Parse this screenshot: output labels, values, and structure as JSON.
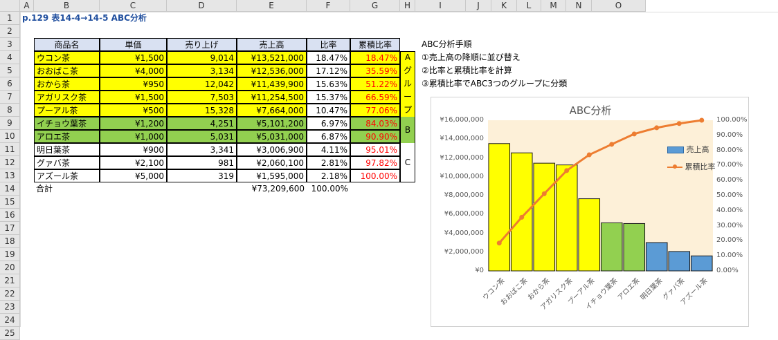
{
  "sheet": {
    "columns": [
      "A",
      "B",
      "C",
      "D",
      "E",
      "F",
      "G",
      "H",
      "I",
      "J",
      "K",
      "L",
      "M",
      "N",
      "O"
    ],
    "rows": [
      "1",
      "2",
      "3",
      "4",
      "5",
      "6",
      "7",
      "8",
      "9",
      "10",
      "11",
      "12",
      "13",
      "14",
      "15",
      "16",
      "17",
      "18",
      "19",
      "20",
      "21",
      "22",
      "23",
      "24",
      "25"
    ],
    "title": "p.129  表14-4→14-5  ABC分析",
    "headers": [
      "商品名",
      "単価",
      "売り上げ",
      "売上高",
      "比率",
      "累積比率"
    ],
    "table": [
      {
        "name": "ウコン茶",
        "price": "¥1,500",
        "qty": "9,014",
        "sales": "¥13,521,000",
        "ratio": "18.47%",
        "cum": "18.47%",
        "group": "A"
      },
      {
        "name": "おおばこ茶",
        "price": "¥4,000",
        "qty": "3,134",
        "sales": "¥12,536,000",
        "ratio": "17.12%",
        "cum": "35.59%",
        "group": "A"
      },
      {
        "name": "おから茶",
        "price": "¥950",
        "qty": "12,042",
        "sales": "¥11,439,900",
        "ratio": "15.63%",
        "cum": "51.22%",
        "group": "A"
      },
      {
        "name": "アガリスク茶",
        "price": "¥1,500",
        "qty": "7,503",
        "sales": "¥11,254,500",
        "ratio": "15.37%",
        "cum": "66.59%",
        "group": "A"
      },
      {
        "name": "プーアル茶",
        "price": "¥500",
        "qty": "15,328",
        "sales": "¥7,664,000",
        "ratio": "10.47%",
        "cum": "77.06%",
        "group": "A"
      },
      {
        "name": "イチョウ葉茶",
        "price": "¥1,200",
        "qty": "4,251",
        "sales": "¥5,101,200",
        "ratio": "6.97%",
        "cum": "84.03%",
        "group": "B"
      },
      {
        "name": "アロエ茶",
        "price": "¥1,000",
        "qty": "5,031",
        "sales": "¥5,031,000",
        "ratio": "6.87%",
        "cum": "90.90%",
        "group": "B"
      },
      {
        "name": "明日葉茶",
        "price": "¥900",
        "qty": "3,341",
        "sales": "¥3,006,900",
        "ratio": "4.11%",
        "cum": "95.01%",
        "group": "C"
      },
      {
        "name": "グァバ茶",
        "price": "¥2,100",
        "qty": "981",
        "sales": "¥2,060,100",
        "ratio": "2.81%",
        "cum": "97.82%",
        "group": "C"
      },
      {
        "name": "アズール茶",
        "price": "¥5,000",
        "qty": "319",
        "sales": "¥1,595,000",
        "ratio": "2.18%",
        "cum": "100.00%",
        "group": "C"
      }
    ],
    "total_label": "合計",
    "total_sales": "¥73,209,600",
    "total_ratio": "100.00%",
    "group_a_label": [
      "A",
      "グ",
      "ル",
      "ー",
      "プ"
    ],
    "group_b_label": "B",
    "group_c_label": "C",
    "procedure": {
      "title": "ABC分析手順",
      "steps": [
        "①売上高の降順に並び替え",
        "②比率と累積比率を計算",
        "③累積比率でABC3つのグループに分類"
      ]
    },
    "colors": {
      "group_a": "#ffff00",
      "group_b": "#92d050",
      "group_c": "#5b9bd5",
      "line": "#ed7d31",
      "header": "#d9e1f2"
    }
  },
  "chart_data": {
    "type": "bar",
    "title": "ABC分析",
    "categories": [
      "ウコン茶",
      "おおばこ茶",
      "おから茶",
      "アガリスク茶",
      "プーアル茶",
      "イチョウ葉茶",
      "アロエ茶",
      "明日葉茶",
      "グァバ茶",
      "アズール茶"
    ],
    "series": [
      {
        "name": "売上高",
        "type": "bar",
        "axis": "left",
        "values": [
          13521000,
          12536000,
          11439900,
          11254500,
          7664000,
          5101200,
          5031000,
          3006900,
          2060100,
          1595000
        ]
      },
      {
        "name": "累積比率",
        "type": "line",
        "axis": "right",
        "values": [
          18.47,
          35.59,
          51.22,
          66.59,
          77.06,
          84.03,
          90.9,
          95.01,
          97.82,
          100.0
        ]
      }
    ],
    "bar_colors": [
      "#ffff00",
      "#ffff00",
      "#ffff00",
      "#ffff00",
      "#ffff00",
      "#92d050",
      "#92d050",
      "#5b9bd5",
      "#5b9bd5",
      "#5b9bd5"
    ],
    "ylim": [
      0,
      16000000
    ],
    "y_ticks": [
      "¥16,000,000",
      "¥14,000,000",
      "¥12,000,000",
      "¥10,000,000",
      "¥8,000,000",
      "¥6,000,000",
      "¥4,000,000",
      "¥2,000,000",
      "¥0"
    ],
    "y2lim": [
      0,
      100
    ],
    "y2_ticks": [
      "100.00%",
      "90.00%",
      "80.00%",
      "70.00%",
      "60.00%",
      "50.00%",
      "40.00%",
      "30.00%",
      "20.00%",
      "10.00%",
      "0.00%"
    ],
    "legend": [
      "売上高",
      "累積比率"
    ],
    "legend_position": "right"
  }
}
